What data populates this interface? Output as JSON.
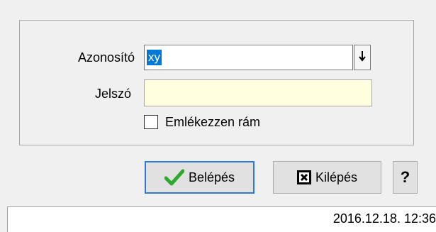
{
  "form": {
    "username_label": "Azonosító",
    "username_value": "xy",
    "password_label": "Jelszó",
    "remember_label": "Emlékezzen rám",
    "remember_checked": false
  },
  "buttons": {
    "login": "Belépés",
    "exit": "Kilépés",
    "help": "?"
  },
  "status": {
    "datetime": "2016.12.18. 12:36"
  },
  "icons": {
    "dropdown": "down-arrow-icon",
    "login": "checkmark-icon",
    "exit": "close-box-icon"
  },
  "colors": {
    "selection": "#0078d7",
    "password_bg": "#ffffe0",
    "default_button_border": "#2b7ad8",
    "check_green": "#2fa82f"
  }
}
